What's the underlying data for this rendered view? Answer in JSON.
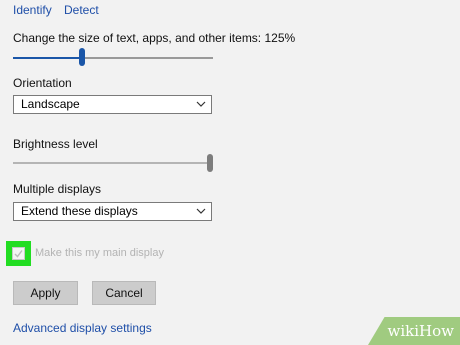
{
  "top_links": {
    "identify": "Identify",
    "detect": "Detect"
  },
  "scale": {
    "label": "Change the size of text, apps, and other items: 125%",
    "level_fraction": 0.33
  },
  "orientation": {
    "label": "Orientation",
    "selected": "Landscape"
  },
  "brightness": {
    "label": "Brightness level",
    "level_fraction": 1.0
  },
  "multiple_displays": {
    "label": "Multiple displays",
    "selected": "Extend these displays"
  },
  "main_display": {
    "label": "Make this my main display",
    "checked": true,
    "enabled": false
  },
  "buttons": {
    "apply": "Apply",
    "cancel": "Cancel"
  },
  "advanced_link": "Advanced display settings",
  "watermark": {
    "text": "wikiHow"
  },
  "colors": {
    "accent": "#1f4fa8",
    "slider_thumb": "#1a56a8",
    "checkbox_highlight": "#22dd22",
    "watermark_green": "#92c46c"
  }
}
